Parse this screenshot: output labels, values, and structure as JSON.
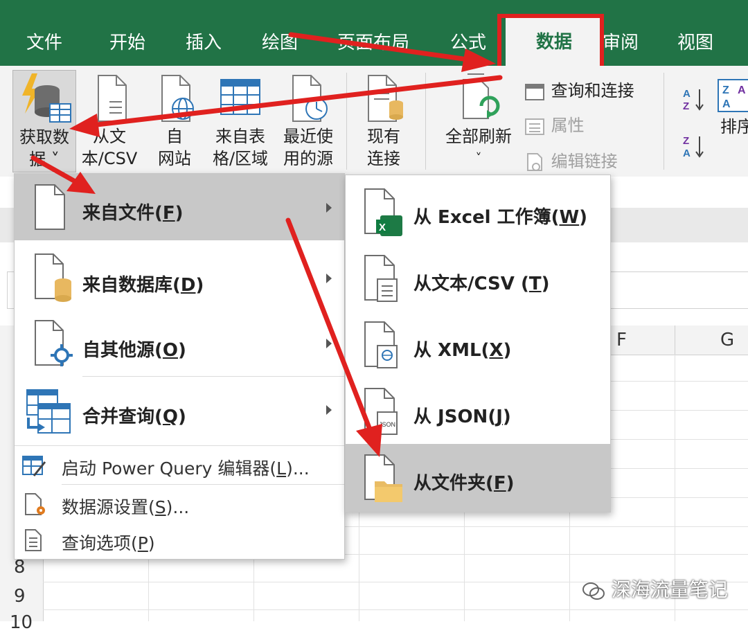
{
  "tabs": [
    "文件",
    "开始",
    "插入",
    "绘图",
    "页面布局",
    "公式",
    "数据",
    "审阅",
    "视图"
  ],
  "active_tab": "数据",
  "ribbon": {
    "get_data": [
      "获取数",
      "据 ˅"
    ],
    "from_text": [
      "从文",
      "本/CSV"
    ],
    "from_web": [
      "自",
      "网站"
    ],
    "from_table": [
      "来自表",
      "格/区域"
    ],
    "recent_sources": [
      "最近使",
      "用的源"
    ],
    "existing_connections": [
      "现有",
      "连接"
    ],
    "refresh_all": "全部刷新",
    "refresh_all_caret": "˅",
    "queries_connections": "查询和连接",
    "properties": "属性",
    "edit_links": "编辑链接",
    "sort": "排序",
    "sort_az_icon": "sort-ascending-icon",
    "sort_za_icon": "sort-descending-icon"
  },
  "sheet": {
    "columns": [
      "F",
      "G"
    ],
    "rows": [
      "8",
      "9",
      "10"
    ]
  },
  "main_menu": {
    "items": [
      {
        "label": "来自文件(",
        "key": "F",
        "suffix": ")"
      },
      {
        "label": "来自数据库(",
        "key": "D",
        "suffix": ")"
      },
      {
        "label": "自其他源(",
        "key": "O",
        "suffix": ")"
      },
      {
        "label": "合并查询(",
        "key": "Q",
        "suffix": ")"
      }
    ],
    "small_items": [
      {
        "label": "启动 Power Query 编辑器(",
        "key": "L",
        "suffix": ")..."
      },
      {
        "label": "数据源设置(",
        "key": "S",
        "suffix": ")..."
      },
      {
        "label": "查询选项(",
        "key": "P",
        "suffix": ")"
      }
    ]
  },
  "sub_menu": {
    "items": [
      {
        "label": "从 Excel 工作簿(",
        "key": "W",
        "suffix": ")"
      },
      {
        "label": "从文本/CSV (",
        "key": "T",
        "suffix": ")"
      },
      {
        "label": "从 XML(",
        "key": "X",
        "suffix": ")"
      },
      {
        "label": "从 JSON(",
        "key": "J",
        "suffix": ")"
      },
      {
        "label": "从文件夹(",
        "key": "F",
        "suffix": ")"
      }
    ],
    "icon_texts": {
      "json": "JSON"
    }
  },
  "watermark": "深海流量笔记",
  "colors": {
    "excel_green": "#217346",
    "arrow_red": "#e0211f",
    "highlight": "#c8c8c8"
  }
}
